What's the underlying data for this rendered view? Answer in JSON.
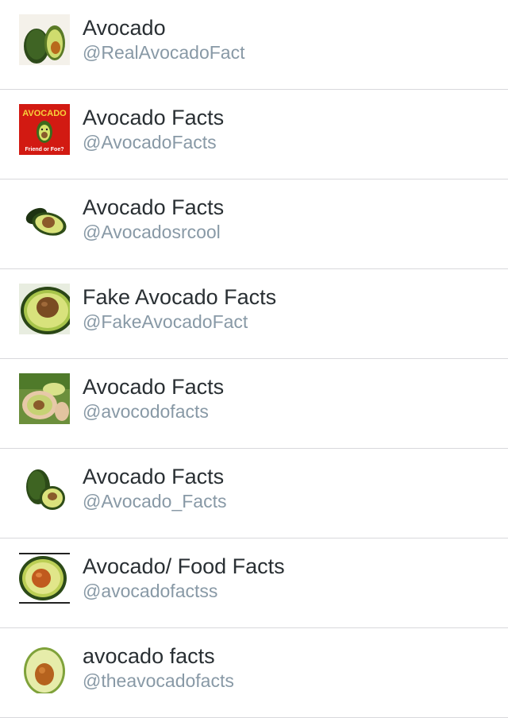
{
  "accounts": [
    {
      "name": "Avocado",
      "handle": "@RealAvocadoFact",
      "avatar_icon": "avocado-pair-icon"
    },
    {
      "name": "Avocado Facts",
      "handle": "@AvocadoFacts",
      "avatar_icon": "avocado-friend-or-foe-logo",
      "avatar_text_top": "AVOCADO",
      "avatar_text_bottom": "Friend or Foe?"
    },
    {
      "name": "Avocado Facts",
      "handle": "@Avocadosrcool",
      "avatar_icon": "avocado-halves-icon"
    },
    {
      "name": "Fake Avocado Facts",
      "handle": "@FakeAvocadoFact",
      "avatar_icon": "avocado-closeup-icon"
    },
    {
      "name": "Avocado Facts",
      "handle": "@avocodofacts",
      "avatar_icon": "avocado-in-hand-photo"
    },
    {
      "name": "Avocado Facts",
      "handle": "@Avocado_Facts",
      "avatar_icon": "avocado-whole-and-half-icon"
    },
    {
      "name": "Avocado/ Food Facts",
      "handle": "@avocadofactss",
      "avatar_icon": "avocado-half-red-pit-icon"
    },
    {
      "name": "avocado facts",
      "handle": "@theavocadofacts",
      "avatar_icon": "avocado-single-half-icon"
    }
  ],
  "colors": {
    "name_text": "#292f33",
    "handle_text": "#8899a6",
    "divider": "#d8d8dc",
    "avocado_skin": "#2f4a1c",
    "avocado_flesh": "#c8d86a",
    "avocado_pit": "#8a5a2b"
  }
}
